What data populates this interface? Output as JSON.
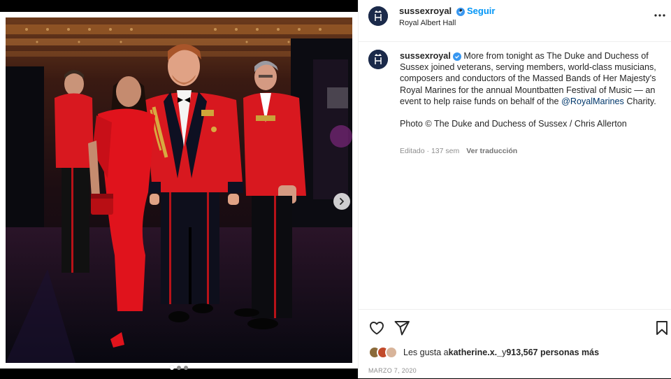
{
  "post": {
    "username": "sussexroyal",
    "follow_label": "Seguir",
    "separator": "•",
    "location": "Royal Albert Hall"
  },
  "caption": {
    "username": "sussexroyal",
    "text_part1": "More from tonight as The Duke and Duchess of Sussex joined veterans, serving members, world-class musicians, composers and conductors of the Massed Bands of Her Majesty's Royal Marines for the annual Mountbatten Festival of Music — an event to help raise funds on behalf of the ",
    "mention": "@RoyalMarines",
    "text_part2": " Charity.",
    "photo_credit": "Photo © The Duke and Duchess of Sussex / Chris Allerton",
    "edited": "Editado · 137 sem",
    "translate_label": "Ver traducción"
  },
  "likes": {
    "prefix": "Les gusta a ",
    "first_user": "katherine.x._",
    "middle": " y ",
    "count_text": "913,567 personas más"
  },
  "date": "MARZO 7, 2020",
  "carousel": {
    "total": 3,
    "current": 1
  },
  "colors": {
    "link_blue": "#0095f6",
    "verified_blue": "#3897f0",
    "muted_gray": "#8e8e8e",
    "uniform_red": "#d8181f",
    "dress_red": "#e0131c"
  },
  "icons": [
    "verified-icon",
    "more-options-icon",
    "heart-icon",
    "share-icon",
    "bookmark-icon",
    "chevron-right-icon",
    "crest-icon"
  ]
}
